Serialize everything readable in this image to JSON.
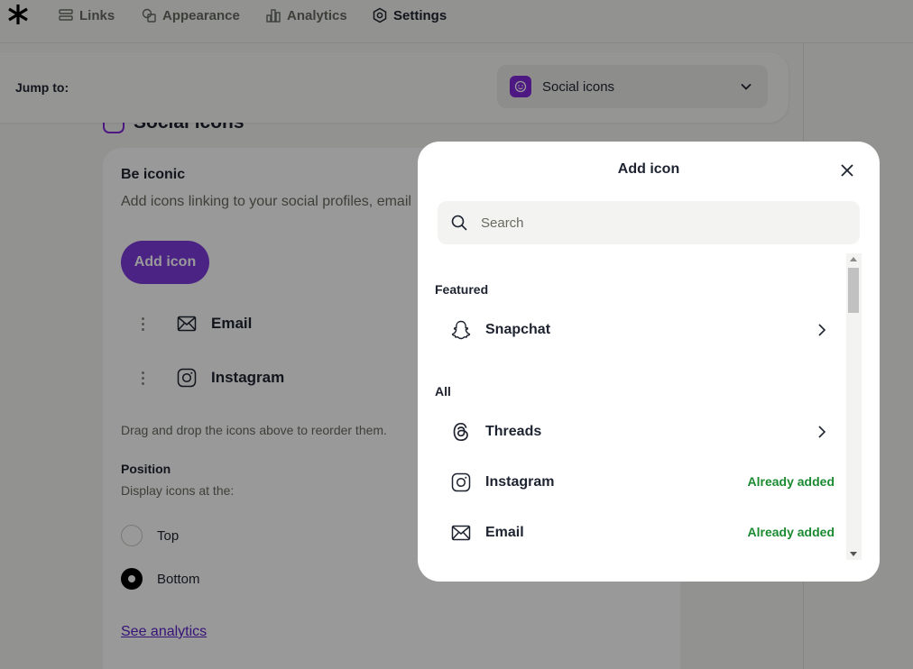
{
  "nav": {
    "items": [
      {
        "label": "Links",
        "icon": "links-icon"
      },
      {
        "label": "Appearance",
        "icon": "appearance-icon"
      },
      {
        "label": "Analytics",
        "icon": "analytics-icon"
      },
      {
        "label": "Settings",
        "icon": "settings-icon"
      }
    ],
    "active": "Settings"
  },
  "jump": {
    "label": "Jump to:",
    "selected": "Social icons"
  },
  "section": {
    "title": "Social icons"
  },
  "card": {
    "heading": "Be iconic",
    "subtitle": "Add icons linking to your social profiles, email",
    "add_button": "Add icon",
    "icons": [
      {
        "name": "Email",
        "icon": "envelope-icon"
      },
      {
        "name": "Instagram",
        "icon": "instagram-icon"
      }
    ],
    "hint": "Drag and drop the icons above to reorder them.",
    "position_label": "Position",
    "position_sub": "Display icons at the:",
    "positions": [
      {
        "label": "Top",
        "selected": false
      },
      {
        "label": "Bottom",
        "selected": true
      }
    ],
    "analytics_link": "See analytics"
  },
  "modal": {
    "title": "Add icon",
    "search_placeholder": "Search",
    "featured_label": "Featured",
    "featured": [
      {
        "name": "Snapchat",
        "icon": "snapchat-icon",
        "status": ""
      }
    ],
    "all_label": "All",
    "all": [
      {
        "name": "Threads",
        "icon": "threads-icon",
        "status": ""
      },
      {
        "name": "Instagram",
        "icon": "instagram-icon",
        "status": "Already added"
      },
      {
        "name": "Email",
        "icon": "envelope-icon",
        "status": "Already added"
      }
    ]
  },
  "colors": {
    "accent": "#8129d9",
    "added_green": "#1a8a30",
    "link_purple": "#5b20c9"
  }
}
